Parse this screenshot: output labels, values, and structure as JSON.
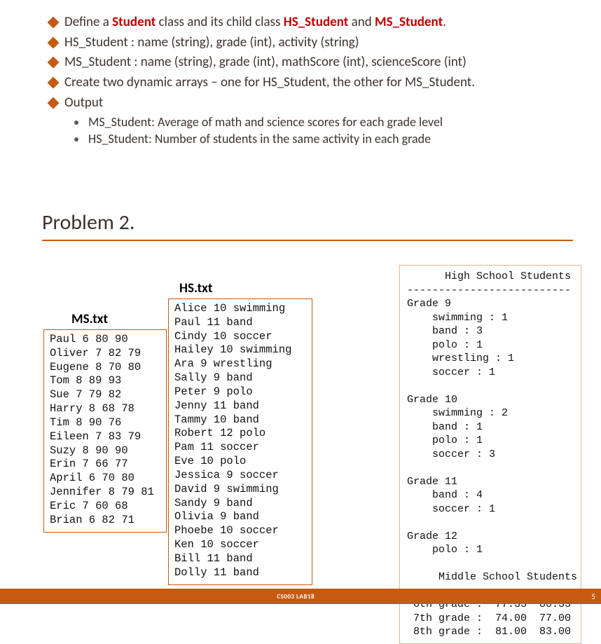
{
  "bullets": [
    {
      "pre": "Define a ",
      "b1": "Student",
      "mid1": " class and its child class ",
      "b2": "HS_Student",
      "mid2": " and ",
      "b3": "MS_Student",
      "post": "."
    },
    {
      "text": "HS_Student : name (string), grade (int), activity (string)"
    },
    {
      "text": "MS_Student : name (string), grade (int), mathScore (int), scienceScore (int)"
    },
    {
      "text": "Create two dynamic arrays – one for HS_Student, the other for MS_Student."
    },
    {
      "text": "Output"
    }
  ],
  "sub_bullets": [
    "MS_Student: Average of math and science scores for each grade level",
    "HS_Student: Number of students in the same activity in each grade"
  ],
  "problem_title": "Problem 2.",
  "ms_label": "MS.txt",
  "hs_label": "HS.txt",
  "ms_txt": "Paul 6 80 90\nOliver 7 82 79\nEugene 8 70 80\nTom 8 89 93\nSue 7 79 82\nHarry 8 68 78\nTim 8 90 76\nEileen 7 83 79\nSuzy 8 90 90\nErin 7 66 77\nApril 6 70 80\nJennifer 8 79 81\nEric 7 60 68\nBrian 6 82 71",
  "hs_txt": "Alice 10 swimming\nPaul 11 band\nCindy 10 soccer\nHailey 10 swimming\nAra 9 wrestling\nSally 9 band\nPeter 9 polo\nJenny 11 band\nTammy 10 band\nRobert 12 polo\nPam 11 soccer\nEve 10 polo\nJessica 9 soccer\nDavid 9 swimming\nSandy 9 band\nOlivia 9 band\nPhoebe 10 soccer\nKen 10 soccer\nBill 11 band\nDolly 11 band",
  "output": "      High School Students\n--------------------------\nGrade 9\n    swimming : 1\n    band : 3\n    polo : 1\n    wrestling : 1\n    soccer : 1\n\nGrade 10\n    swimming : 2\n    band : 1\n    polo : 1\n    soccer : 3\n\nGrade 11\n    band : 4\n    soccer : 1\n\nGrade 12\n    polo : 1\n\n     Middle School Students\n---------------------------\n 6th grade :  77.33  80.33\n 7th grade :  74.00  77.00\n 8th grade :  81.00  83.00",
  "footer_label": "CS003 LAB18",
  "footer_num": "5"
}
